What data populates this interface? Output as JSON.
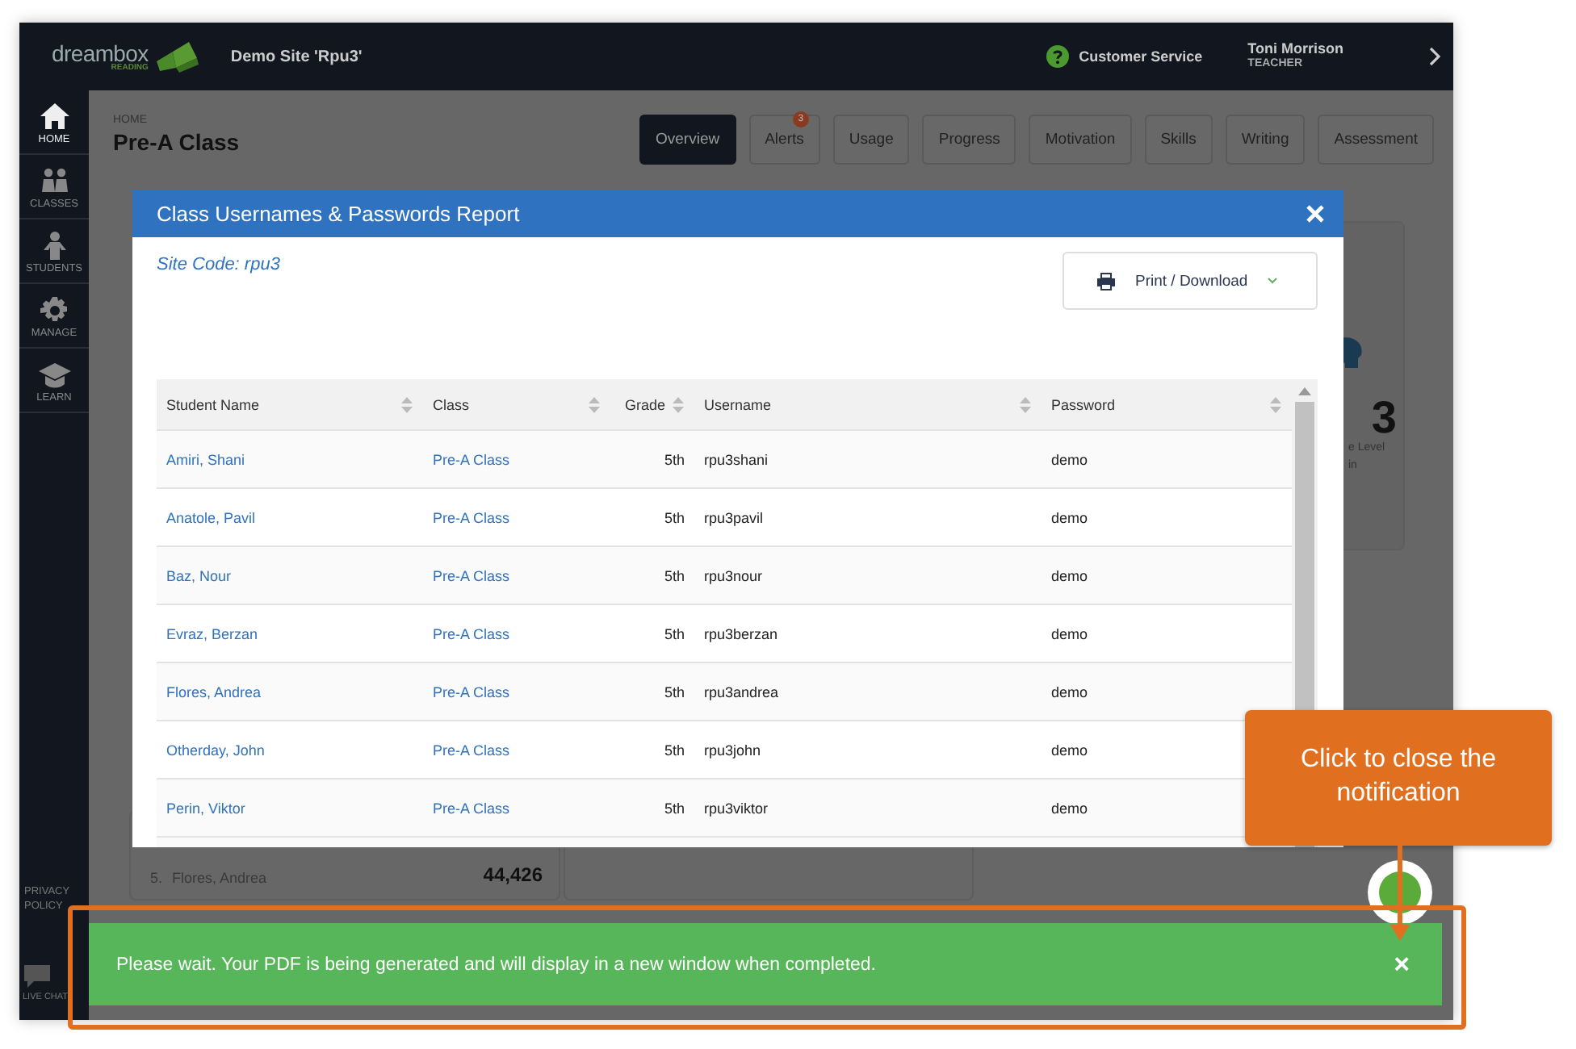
{
  "top_bar": {
    "logo": {
      "word": "dreambox",
      "sub": "READING"
    },
    "site": "Demo Site 'Rpu3'",
    "help": "Customer Service",
    "user": {
      "name": "Toni Morrison",
      "role": "TEACHER"
    }
  },
  "sidebar": {
    "items": [
      {
        "label": "HOME",
        "kind": "home",
        "selected": true
      },
      {
        "label": "CLASSES",
        "kind": "classes",
        "selected": false
      },
      {
        "label": "STUDENTS",
        "kind": "students",
        "selected": false
      },
      {
        "label": "MANAGE",
        "kind": "manage",
        "selected": false
      },
      {
        "label": "LEARN",
        "kind": "learn",
        "selected": false
      }
    ],
    "footer": [
      {
        "label": "PRIVACY POLICY",
        "kind": "link"
      },
      {
        "label": "LIVE CHAT",
        "kind": "chat"
      }
    ]
  },
  "page": {
    "breadcrumb": "HOME",
    "title": "Pre-A Class",
    "tabs": [
      {
        "label": "Overview",
        "selected": true
      },
      {
        "label": "Alerts",
        "selected": false,
        "badge": "3"
      },
      {
        "label": "Usage",
        "selected": false
      },
      {
        "label": "Progress",
        "selected": false
      },
      {
        "label": "Motivation",
        "selected": false
      },
      {
        "label": "Skills",
        "selected": false
      },
      {
        "label": "Writing",
        "selected": false
      },
      {
        "label": "Assessment",
        "selected": false
      }
    ]
  },
  "background_cards": {
    "stat": {
      "value": "3",
      "caption_1": "e Level",
      "caption_2": "in"
    },
    "leaderboard_row": {
      "rank": "5.",
      "name": "Flores, Andrea",
      "score": "44,426"
    }
  },
  "modal": {
    "title": "Class Usernames & Passwords Report",
    "site_code": "Site Code: rpu3",
    "print_button": "Print / Download",
    "table": {
      "columns": [
        "Student Name",
        "Class",
        "Grade",
        "Username",
        "Password"
      ],
      "rows": [
        [
          "Amiri, Shani",
          "Pre-A Class",
          "5th",
          "rpu3shani",
          "demo"
        ],
        [
          "Anatole, Pavil",
          "Pre-A Class",
          "5th",
          "rpu3pavil",
          "demo"
        ],
        [
          "Baz, Nour",
          "Pre-A Class",
          "5th",
          "rpu3nour",
          "demo"
        ],
        [
          "Evraz, Berzan",
          "Pre-A Class",
          "5th",
          "rpu3berzan",
          "demo"
        ],
        [
          "Flores, Andrea",
          "Pre-A Class",
          "5th",
          "rpu3andrea",
          "demo"
        ],
        [
          "Otherday, John",
          "Pre-A Class",
          "5th",
          "rpu3john",
          "demo"
        ],
        [
          "Perin, Viktor",
          "Pre-A Class",
          "5th",
          "rpu3viktor",
          "demo"
        ]
      ]
    }
  },
  "notification": {
    "message": "Please wait. Your PDF is being generated and will display in a new window when completed.",
    "close": "×"
  },
  "callout": {
    "text": "Click to close the notification"
  }
}
